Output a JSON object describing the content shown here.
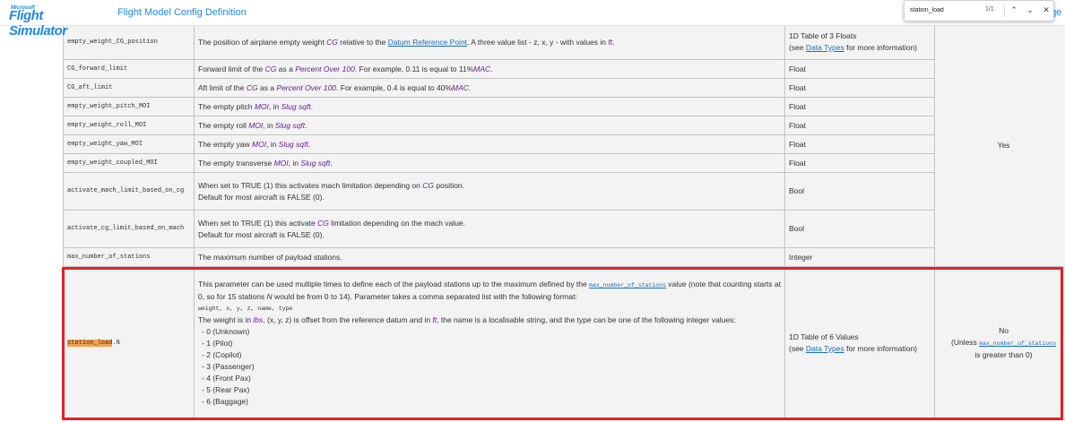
{
  "header": {
    "logo_small": "Microsoft",
    "logo_big": "Flight Simulator",
    "site_title": "Flight Model Config Definition",
    "right_partial": "age"
  },
  "find": {
    "query": "station_load",
    "count": "1/1",
    "up_icon": "chevron-up-icon",
    "down_icon": "chevron-down-icon",
    "close_icon": "close-icon"
  },
  "rows": {
    "r0": {
      "name": "empty_weight_CG_position",
      "d_a": "The position of airplane empty weight ",
      "d_cg": "CG",
      "d_b": " relative to the ",
      "d_link": "Datum Reference Point",
      "d_c": ". A three value list - z, x, y - with values in ",
      "d_ft": "ft",
      "d_end": ".",
      "type_a": "1D Table of 3 Floats",
      "type_b1": "(see ",
      "type_link": "Data Types",
      "type_b2": " for more information)"
    },
    "r1": {
      "name": "CG_forward_limit",
      "d_a": "Forward limit of the ",
      "d_cg": "CG",
      "d_b": " as a ",
      "d_pct": "Percent Over 100",
      "d_c": ". For example, 0.11 is equal to 11%",
      "d_mac": "MAC",
      "d_end": ".",
      "type": "Float"
    },
    "r2": {
      "name": "CG_aft_limit",
      "d_a": "Aft limit of the ",
      "d_cg": "CG",
      "d_b": " as a ",
      "d_pct": "Percent Over 100",
      "d_c": ". For example, 0.4 is equal to 40%",
      "d_mac": "MAC",
      "d_end": ".",
      "type": "Float"
    },
    "r3": {
      "name": "empty_weight_pitch_MOI",
      "d_a": "The empty pitch ",
      "d_moi": "MOI",
      "d_b": ", in ",
      "d_unit": "Slug sqft",
      "d_end": ".",
      "type": "Float"
    },
    "r4": {
      "name": "empty_weight_roll_MOI",
      "d_a": "The empty roll ",
      "d_moi": "MOI",
      "d_b": ", in ",
      "d_unit": "Slug sqft",
      "d_end": ".",
      "type": "Float"
    },
    "r5": {
      "name": "empty_weight_yaw_MOI",
      "d_a": "The empty yaw ",
      "d_moi": "MOI",
      "d_b": ", in ",
      "d_unit": "Slug sqft",
      "d_end": ".",
      "type": "Float"
    },
    "r6": {
      "name": "empty_weight_coupled_MOI",
      "d_a": "The empty transverse ",
      "d_moi": "MOI",
      "d_b": ", in ",
      "d_unit": "Slug sqft",
      "d_end": ".",
      "type": "Float"
    },
    "r7": {
      "name": "activate_mach_limit_based_on_cg",
      "d1_a": "When set to TRUE (1) this activates mach limitation depending on ",
      "d1_cg": "CG",
      "d1_b": " position.",
      "d2": "Default for most aircraft is FALSE (0).",
      "type": "Bool"
    },
    "r8": {
      "name": "activate_cg_limit_based_on_mach",
      "d1_a": "When set to TRUE (1) this activate ",
      "d1_cg": "CG",
      "d1_b": " limitation depending on the mach value.",
      "d2": "Default for most aircraft is FALSE (0).",
      "type": "Bool"
    },
    "r9": {
      "name": "max_number_of_stations",
      "desc": "The maximum number of payload stations.",
      "type": "Integer"
    },
    "r10": {
      "name_hl": "station_load",
      "name_suffix": ".N",
      "p1_a": "This parameter can be used multiple times to define each of the payload stations up to the maximum defined by the ",
      "p1_code": "max_number_of_stations",
      "p1_b": " value (note that counting starts at 0, so for 15 stations ",
      "p1_n": "N",
      "p1_c": " would be from 0 to 14). Parameter takes a comma separated list with the following format:",
      "format": "weight, x, y, z, name, type",
      "p2_a": "The weight is in ",
      "p2_lbs": "lbs",
      "p2_b": ", (x, y, z) is offset from the reference datum and in ",
      "p2_ft": "ft",
      "p2_c": ", the name is a localisable string, and the type can be one of the following integer values:",
      "list": [
        "- 0 (Unknown)",
        "- 1 (Pilot)",
        "- 2 (Copilot)",
        "- 3 (Passenger)",
        "- 4 (Front Pax)",
        "- 5 (Rear Pax)",
        "- 6 (Baggage)"
      ],
      "type_a": "1D Table of 6 Values",
      "type_b1": "(see ",
      "type_link": "Data Types",
      "type_b2": " for more information)",
      "req_a": "No",
      "req_b1": "(Unless ",
      "req_code": "max_number_of_stations",
      "req_c": "is greater than 0)"
    }
  },
  "required_group": "Yes",
  "colors": {
    "accent": "#1e88e5",
    "highlight": "#f7a04a",
    "annotation_box": "#e32028"
  }
}
